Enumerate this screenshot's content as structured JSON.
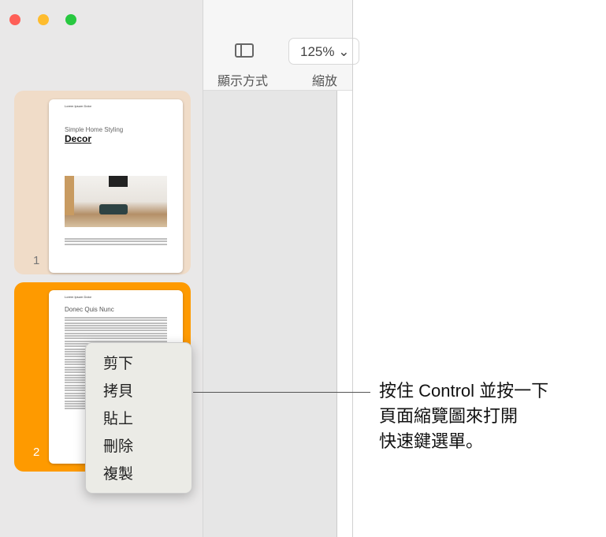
{
  "toolbar": {
    "view_label": "顯示方式",
    "zoom_label": "縮放",
    "zoom_value": "125%"
  },
  "thumbnails": [
    {
      "number": "1",
      "header": "Lorem Ipsum Dolor",
      "subtitle": "Simple Home Styling",
      "title": "Decor",
      "selected": false
    },
    {
      "number": "2",
      "header": "Lorem Ipsum Dolor",
      "title": "Donec Quis Nunc",
      "selected": true
    }
  ],
  "context_menu": [
    "剪下",
    "拷貝",
    "貼上",
    "刪除",
    "複製"
  ],
  "callout": {
    "lines": [
      "按住 Control 並按一下",
      "頁面縮覽圖來打開",
      "快速鍵選單。"
    ]
  },
  "colors": {
    "selected": "#fe9a00",
    "hover": "#f0dcc8"
  }
}
